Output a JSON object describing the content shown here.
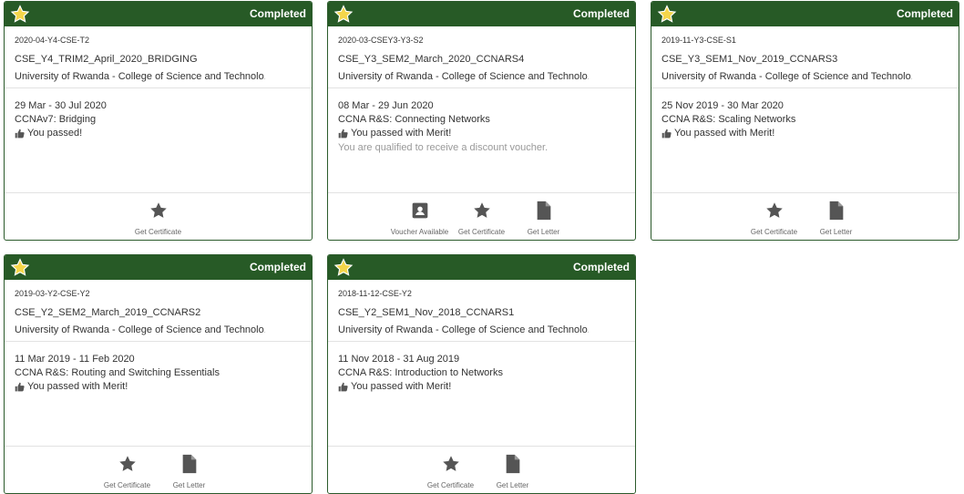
{
  "cards": [
    {
      "status": "Completed",
      "code": "2020-04-Y4-CSE-T2",
      "name": "CSE_Y4_TRIM2_April_2020_BRIDGING",
      "org": "University of Rwanda - College of Science and Technolo...",
      "dates": "29 Mar - 30 Jul 2020",
      "course": "CCNAv7: Bridging",
      "result": "You passed!",
      "note": "",
      "actions": [
        "Get Certificate"
      ]
    },
    {
      "status": "Completed",
      "code": "2020-03-CSEY3-Y3-S2",
      "name": "CSE_Y3_SEM2_March_2020_CCNARS4",
      "org": "University of Rwanda - College of Science and Technolo...",
      "dates": "08 Mar - 29 Jun 2020",
      "course": "CCNA R&S: Connecting Networks",
      "result": "You passed with Merit!",
      "note": "You are qualified to receive a discount voucher.",
      "actions": [
        "Voucher Available",
        "Get Certificate",
        "Get Letter"
      ]
    },
    {
      "status": "Completed",
      "code": "2019-11-Y3-CSE-S1",
      "name": "CSE_Y3_SEM1_Nov_2019_CCNARS3",
      "org": "University of Rwanda - College of Science and Technolo...",
      "dates": "25 Nov 2019 - 30 Mar 2020",
      "course": "CCNA R&S: Scaling Networks",
      "result": "You passed with Merit!",
      "note": "",
      "actions": [
        "Get Certificate",
        "Get Letter"
      ]
    },
    {
      "status": "Completed",
      "code": "2019-03-Y2-CSE-Y2",
      "name": "CSE_Y2_SEM2_March_2019_CCNARS2",
      "org": "University of Rwanda - College of Science and Technolo...",
      "dates": "11 Mar 2019 - 11 Feb 2020",
      "course": "CCNA R&S: Routing and Switching Essentials",
      "result": "You passed with Merit!",
      "note": "",
      "actions": [
        "Get Certificate",
        "Get Letter"
      ]
    },
    {
      "status": "Completed",
      "code": "2018-11-12-CSE-Y2",
      "name": "CSE_Y2_SEM1_Nov_2018_CCNARS1",
      "org": "University of Rwanda - College of Science and Technolo...",
      "dates": "11 Nov 2018 - 31 Aug 2019",
      "course": "CCNA R&S: Introduction to Networks",
      "result": "You passed with Merit!",
      "note": "",
      "actions": [
        "Get Certificate",
        "Get Letter"
      ]
    }
  ],
  "icons": {
    "badge": "star-icon",
    "result": "thumbs-up-icon",
    "Voucher Available": "voucher-icon",
    "Get Certificate": "star-icon",
    "Get Letter": "document-icon"
  },
  "colors": {
    "header": "#275a26",
    "badge_star": "#f5d64a",
    "icon": "#555555"
  }
}
